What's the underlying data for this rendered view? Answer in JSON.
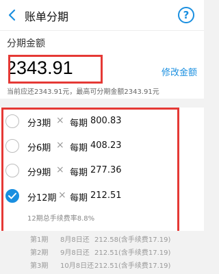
{
  "header": {
    "title": "账单分期",
    "help_glyph": "?"
  },
  "amount": {
    "label": "分期金额",
    "value": "2343.91",
    "modify_label": "修改金额",
    "hint": "当前应还2343.91元，最高可分期金额2343.91元"
  },
  "options": [
    {
      "period": "分3期",
      "times": "×",
      "per_label": "每期",
      "per_amount": "800.83",
      "checked": false
    },
    {
      "period": "分6期",
      "times": "×",
      "per_label": "每期",
      "per_amount": "408.23",
      "checked": false
    },
    {
      "period": "分9期",
      "times": "×",
      "per_label": "每期",
      "per_amount": "277.36",
      "checked": false
    },
    {
      "period": "分12期",
      "times": "×",
      "per_label": "每期",
      "per_amount": "212.51",
      "checked": true
    }
  ],
  "fee_note": "12期总手续费率8.8%",
  "schedule": [
    {
      "term": "第1期",
      "date": "8月8日还",
      "detail": "212.58(含手续费17.19)"
    },
    {
      "term": "第2期",
      "date": "9月8日还",
      "detail": "212.51(含手续费17.19)"
    },
    {
      "term": "第3期",
      "date": "10月8日还",
      "detail": "212.51(含手续费17.19)"
    }
  ],
  "colors": {
    "accent": "#1a8fe0",
    "highlight_border": "#e53935"
  }
}
